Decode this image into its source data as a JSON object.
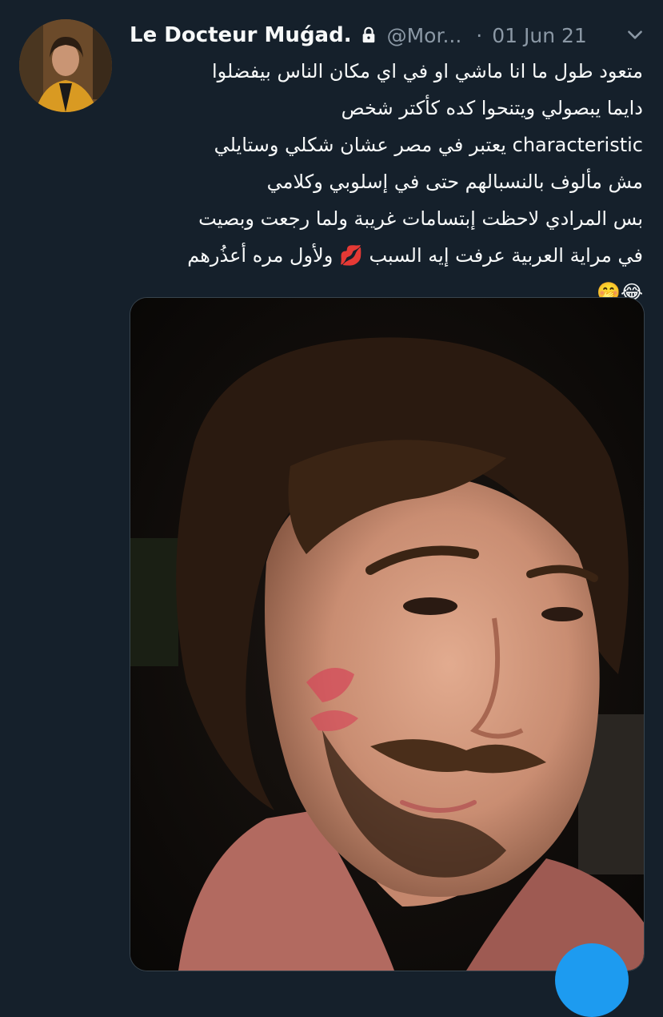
{
  "tweet": {
    "display_name": "Le Docteur Muǵad.",
    "handle": "@Mor...",
    "separator": "·",
    "date": "01 Jun 21",
    "text_lines": [
      "متعود طول ما انا ماشي او في اي مكان الناس بيفضلوا",
      "دايما يبصولي ويتنحوا كده كأكتر شخص",
      "characteristic يعتبر في مصر عشان شكلي وستايلي",
      "مش مألوف بالنسبالهم حتى في إسلوبي وكلامي",
      "بس المرادي لاحظت إبتسامات غريبة ولما رجعت وبصيت",
      "في مراية العربية عرفت إيه السبب 💋 ولأول مره أعذُرهم",
      "😂🤭"
    ]
  },
  "icons": {
    "lock": "lock-icon",
    "more": "more-icon",
    "avatar": "profile-photo"
  },
  "colors": {
    "background": "#15202b",
    "text": "#f7f9f9",
    "secondary": "#8b98a5",
    "accent": "#1d9bf0"
  }
}
